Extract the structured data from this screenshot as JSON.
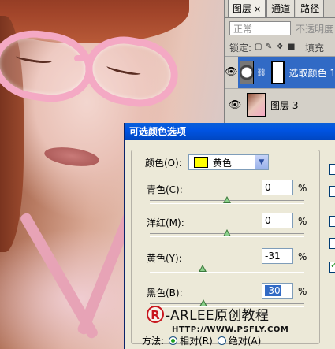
{
  "layers_panel": {
    "tabs": [
      {
        "label": "图层",
        "close": "×",
        "active": true
      },
      {
        "label": "通道",
        "active": false
      },
      {
        "label": "路径",
        "active": false
      }
    ],
    "blend_mode": "正常",
    "opacity_label": "不透明度",
    "lock_label": "锁定:",
    "fill_label": "填充",
    "layers": [
      {
        "name": "选取颜色 1",
        "selected": true,
        "thumb": "adjustment-icon"
      },
      {
        "name": "图层 3",
        "selected": false,
        "thumb": "photo"
      }
    ]
  },
  "dialog": {
    "title": "可选颜色选项",
    "colors_label": "颜色(O):",
    "colors_value": "黄色",
    "swatch_color": "#ffff00",
    "sliders": [
      {
        "label": "青色(C):",
        "value": "0",
        "unit": "%"
      },
      {
        "label": "洋红(M):",
        "value": "0",
        "unit": "%"
      },
      {
        "label": "黄色(Y):",
        "value": "-31",
        "unit": "%"
      },
      {
        "label": "黑色(B):",
        "value": "-30",
        "unit": "%"
      }
    ],
    "method_label": "方法:",
    "method_relative": "相对(R)",
    "method_absolute": "绝对(A)",
    "method_selected": "relative"
  },
  "watermark": {
    "logo": "R",
    "text": "-ARLEE原创教程",
    "url": "HTTP://WWW.PSFLY.COM"
  }
}
